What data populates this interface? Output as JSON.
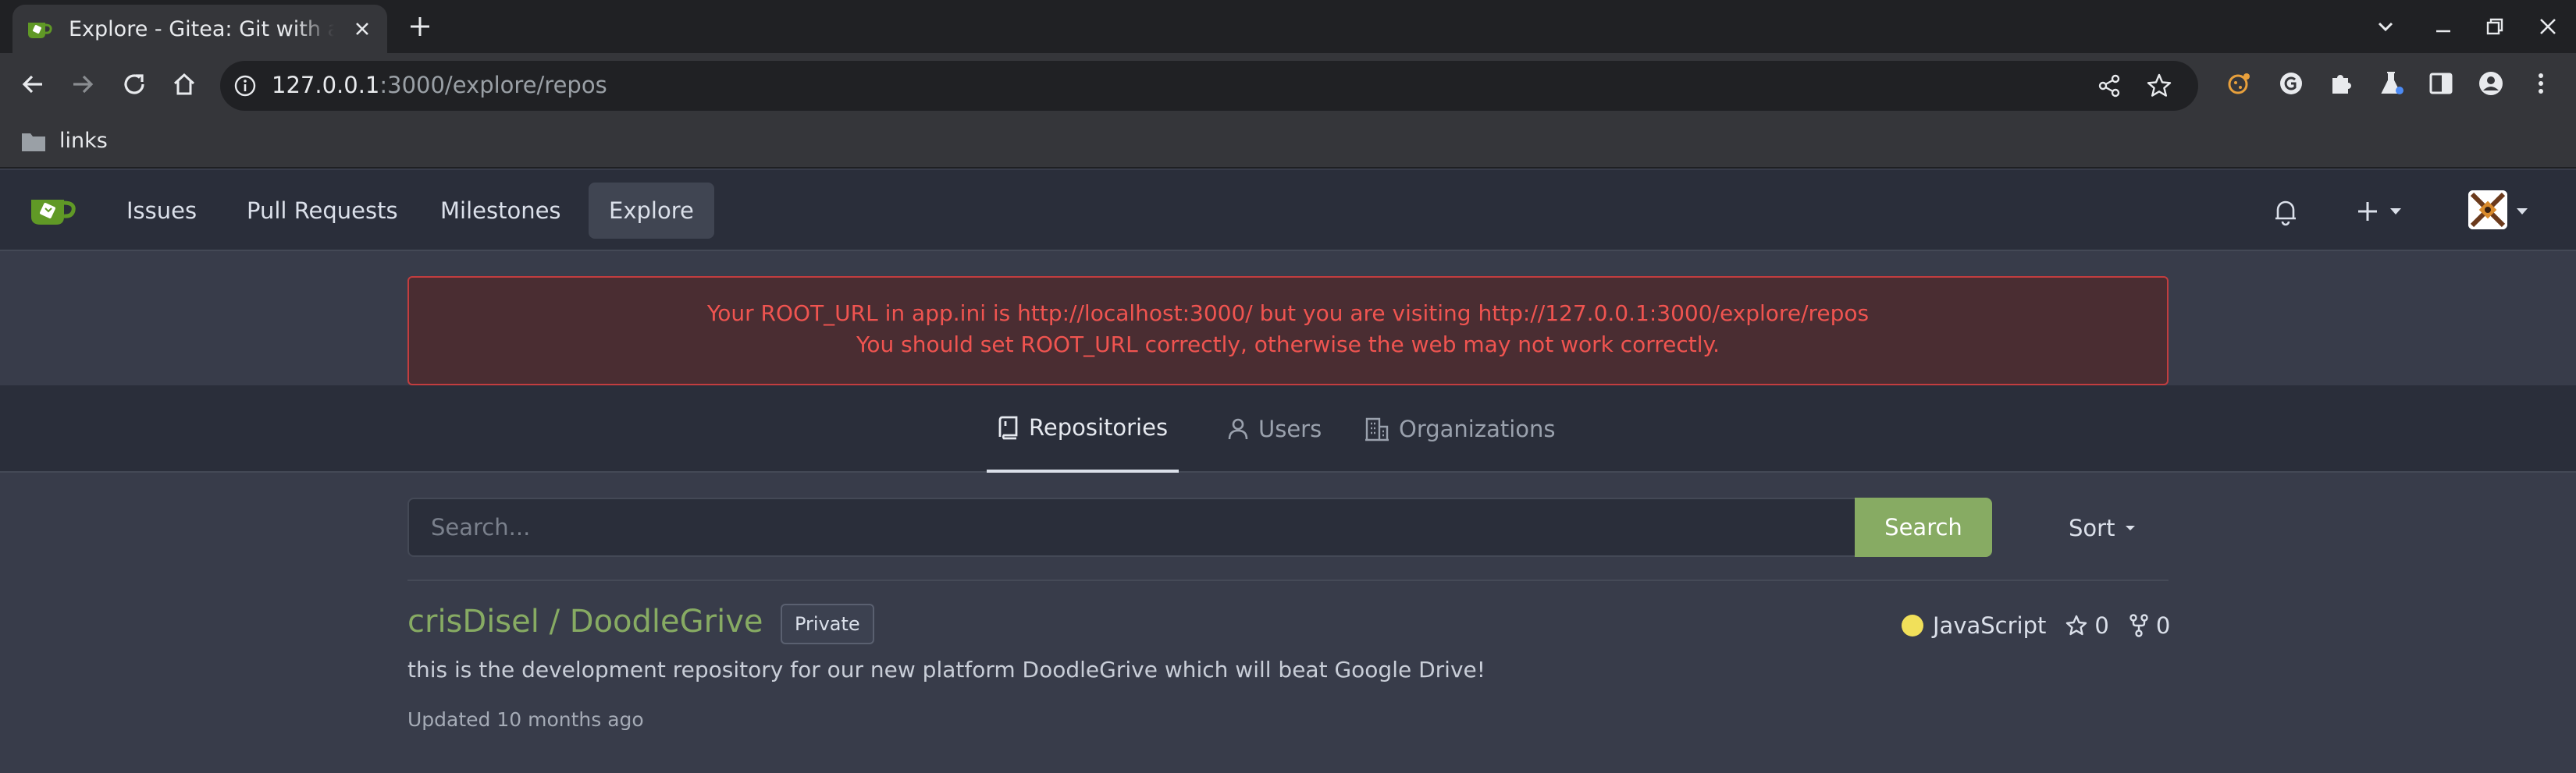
{
  "browser": {
    "tab_title": "Explore - Gitea: Git with a cup of tea",
    "url_host": "127.0.0.1",
    "url_path": ":3000/explore/repos",
    "bookmark_folder": "links"
  },
  "navbar": {
    "items": [
      {
        "label": "Issues"
      },
      {
        "label": "Pull Requests"
      },
      {
        "label": "Milestones"
      },
      {
        "label": "Explore"
      }
    ],
    "active": "Explore"
  },
  "warning": {
    "line1": "Your ROOT_URL in app.ini is http://localhost:3000/ but you are visiting http://127.0.0.1:3000/explore/repos",
    "line2": "You should set ROOT_URL correctly, otherwise the web may not work correctly."
  },
  "explore_tabs": [
    {
      "label": "Repositories",
      "icon": "repo-icon",
      "active": true
    },
    {
      "label": "Users",
      "icon": "person-icon",
      "active": false
    },
    {
      "label": "Organizations",
      "icon": "organization-icon",
      "active": false
    }
  ],
  "search": {
    "placeholder": "Search...",
    "value": "",
    "button_label": "Search",
    "sort_label": "Sort"
  },
  "repos": [
    {
      "full_name": "crisDisel / DoodleGrive",
      "visibility": "Private",
      "language": "JavaScript",
      "language_color": "#f1e05a",
      "stars": "0",
      "forks": "0",
      "description": "this is the development repository for our new platform DoodleGrive which will beat Google Drive!",
      "updated": "Updated 10 months ago"
    }
  ],
  "colors": {
    "accent_green": "#87ab63",
    "warning_text": "#f05450",
    "warning_bg": "#4a2d32"
  }
}
